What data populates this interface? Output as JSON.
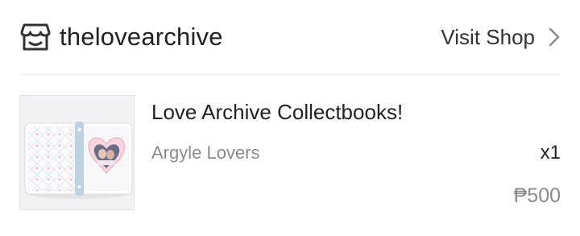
{
  "shop": {
    "name": "thelovearchive",
    "icon": "store-icon",
    "visit_label": "Visit Shop",
    "visit_icon": "chevron-right-icon"
  },
  "product": {
    "title": "Love Archive Collectbooks!",
    "variant": "Argyle Lovers",
    "quantity": "x1",
    "price": "₱500",
    "image": "collectbook-binder-image"
  },
  "colors": {
    "text_primary": "#222222",
    "text_secondary": "#8a8a8a",
    "divider": "#e8e8e8"
  }
}
